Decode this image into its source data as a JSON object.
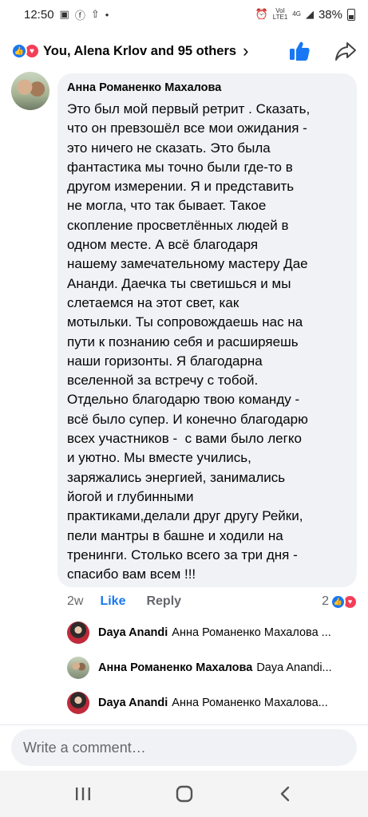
{
  "status_bar": {
    "time": "12:50",
    "network_top": "VoI",
    "network_bottom": "LTE1",
    "signal": "4G",
    "battery": "38%"
  },
  "header": {
    "reactions_summary": "You, Alena  Krlov and 95 others",
    "like_icon": "thumbs-up-icon",
    "share_icon": "share-icon"
  },
  "comment": {
    "author": "Анна Романенко Махалова",
    "text": "Это был мой первый ретрит . Сказать,\nчто он превзошёл все мои ожидания -\nэто ничего не сказать. Это была\nфантастика мы точно были где-то в\nдругом измерении. Я и представить\nне могла, что так бывает. Такое\nскопление просветлённых людей в\nодном месте. А всё благодаря\nнашему замечательному мастеру Дае\nАнанди. Даечка ты светишься и мы\nслетаемся на этот свет, как\nмотыльки. Ты сопровождаешь нас на\nпути к познанию себя и расширяешь\nнаши горизонты. Я благодарна\nвселенной за встречу с тобой.\nОтдельно благодарю твою команду -\nвсё было супер. И конечно благодарю\nвсех участников -  с вами было легко\nи уютно. Мы вместе учились,\nзаряжались энергией, занимались\nйогой и глубинными\nпрактиками,делали друг другу Рейки,\nпели мантры в башне и ходили на\nтренинги. Столько всего за три дня -\nспасибо вам всем !!!",
    "time": "2w",
    "like_label": "Like",
    "reply_label": "Reply",
    "reaction_count": "2"
  },
  "replies": [
    {
      "name": "Daya Anandi",
      "preview": "Анна Романенко Махалова ..."
    },
    {
      "name": "Анна Романенко Махалова",
      "preview": "Daya Anandi..."
    },
    {
      "name": "Daya Anandi",
      "preview": "Анна Романенко Махалова..."
    }
  ],
  "composer": {
    "placeholder": "Write a comment…"
  },
  "colors": {
    "accent": "#1877f2",
    "love": "#f33e58",
    "bubble": "#f0f2f5",
    "secondary_text": "#65676b"
  }
}
